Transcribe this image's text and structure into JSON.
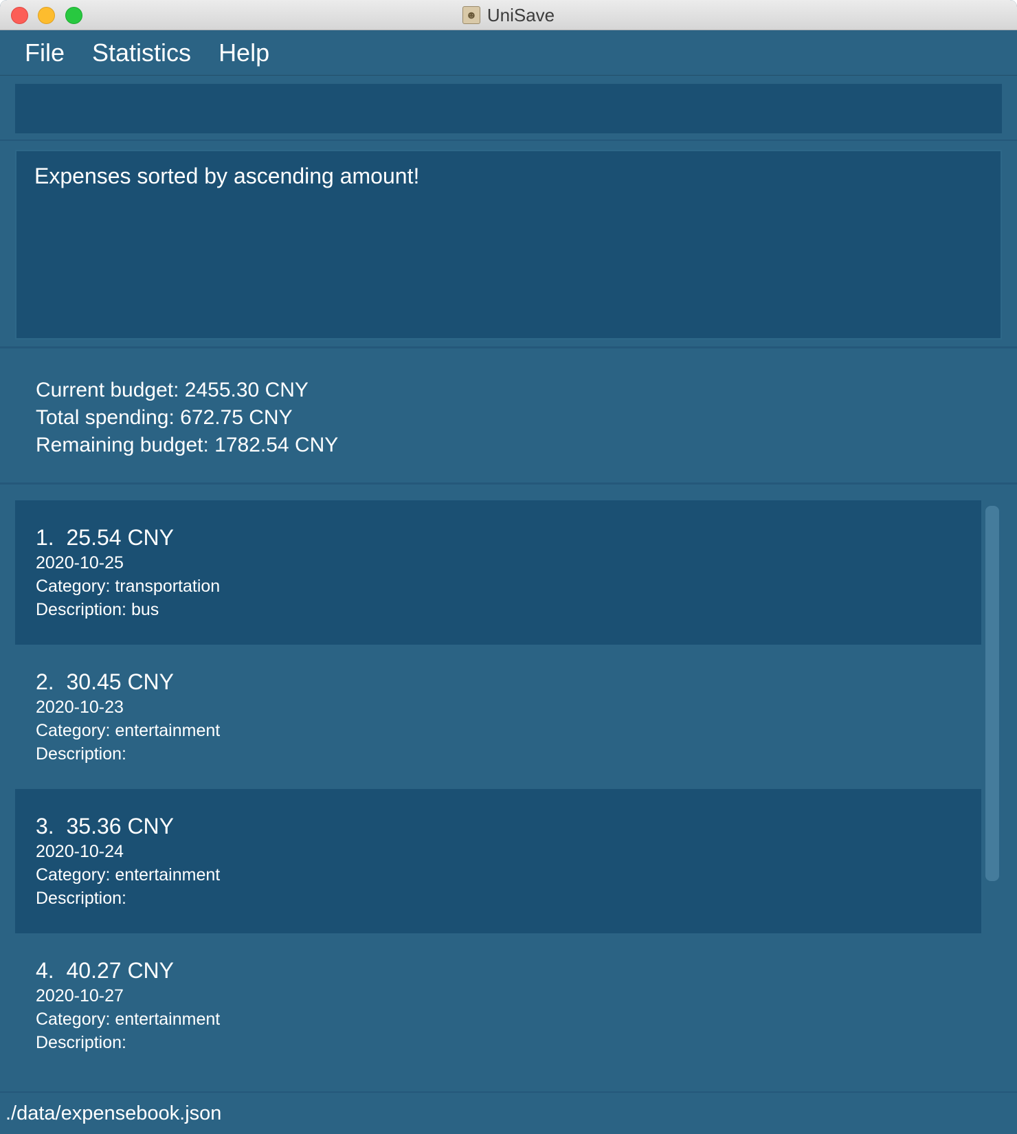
{
  "window": {
    "title": "UniSave"
  },
  "menu": {
    "items": [
      "File",
      "Statistics",
      "Help"
    ]
  },
  "command_box": {
    "value": ""
  },
  "result_display": {
    "message": "Expenses sorted by ascending amount!"
  },
  "budget": {
    "current": "Current budget: 2455.30 CNY",
    "total": "Total spending: 672.75 CNY",
    "remaining": "Remaining budget: 1782.54 CNY"
  },
  "expenses": [
    {
      "index": "1.",
      "amount": "25.54 CNY",
      "date": "2020-10-25",
      "category": "Category: transportation",
      "description": "Description: bus"
    },
    {
      "index": "2.",
      "amount": "30.45 CNY",
      "date": "2020-10-23",
      "category": "Category: entertainment",
      "description": "Description:"
    },
    {
      "index": "3.",
      "amount": "35.36 CNY",
      "date": "2020-10-24",
      "category": "Category: entertainment",
      "description": "Description:"
    },
    {
      "index": "4.",
      "amount": "40.27 CNY",
      "date": "2020-10-27",
      "category": "Category: entertainment",
      "description": "Description:"
    }
  ],
  "status_bar": {
    "file_path": "./data/expensebook.json"
  },
  "colors": {
    "window_bg": "#2b6384",
    "panel_dark": "#1b5073",
    "text": "#ffffff"
  }
}
